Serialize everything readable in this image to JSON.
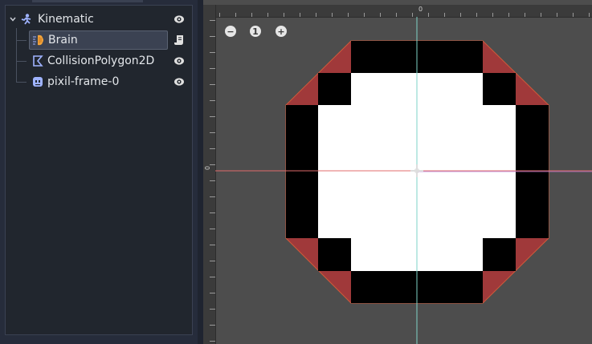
{
  "scene_tree": {
    "nodes": [
      {
        "label": "Kinematic",
        "icon": "kinematic-body-icon",
        "selected": false,
        "right_icon": "visibility-eye-icon"
      },
      {
        "label": "Brain",
        "icon": "brain-node-icon",
        "selected": true,
        "right_icon": "script-icon"
      },
      {
        "label": "CollisionPolygon2D",
        "icon": "collision-polygon-icon",
        "selected": false,
        "right_icon": "visibility-eye-icon"
      },
      {
        "label": "pixil-frame-0",
        "icon": "sprite-icon",
        "selected": false,
        "right_icon": "visibility-eye-icon"
      }
    ]
  },
  "viewport": {
    "zoom_buttons": {
      "zoom_out": "−",
      "zoom_reset": "1",
      "zoom_in": "+"
    },
    "ruler": {
      "top_origin_label": "0",
      "left_origin_label": "0"
    },
    "colors": {
      "background": "#4d4d4d",
      "x_axis": "#e06c6c",
      "y_axis": "#7ed3c8",
      "collision_polygon": "#a0393a",
      "collision_outline": "#d05a3a",
      "sprite_border": "#000000",
      "sprite_fill": "#ffffff"
    }
  }
}
